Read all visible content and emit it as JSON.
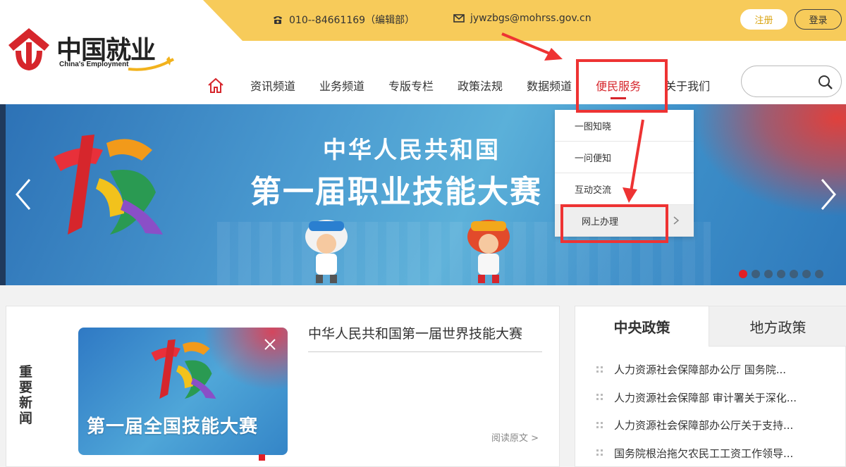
{
  "topbar": {
    "phone": "010--84661169（编辑部）",
    "email": "jywzbgs@mohrss.gov.cn",
    "register_label": "注册",
    "login_label": "登录"
  },
  "logo": {
    "cn": "中国就业",
    "en": "China's Employment"
  },
  "nav": {
    "items": [
      "资讯频道",
      "业务频道",
      "专版专栏",
      "政策法规",
      "数据频道",
      "便民服务",
      "关于我们"
    ],
    "active": "便民服务"
  },
  "search": {
    "value": ""
  },
  "banner": {
    "title_line1": "中华人民共和国",
    "title_line2": "第一届职业技能大赛",
    "slide_count": 7,
    "active_slide": 1
  },
  "dropdown": {
    "items": [
      "一图知晓",
      "一问便知",
      "互动交流",
      "网上办理"
    ]
  },
  "news": {
    "section_label": "重要新闻",
    "image_caption": "第一届全国技能大赛",
    "headline": "中华人民共和国第一届世界技能大赛",
    "read_more": "阅读原文 >"
  },
  "policy": {
    "tabs": [
      "中央政策",
      "地方政策"
    ],
    "active_tab": "中央政策",
    "items": [
      "人力资源社会保障部办公厅 国务院...",
      "人力资源社会保障部 审计署关于深化...",
      "人力资源社会保障部办公厅关于支持...",
      "国务院根治拖欠农民工工资工作领导..."
    ]
  },
  "colors": {
    "accent_red": "#d6262c",
    "topbar_yellow": "#f7cb5a",
    "highlight": "#e33333"
  }
}
